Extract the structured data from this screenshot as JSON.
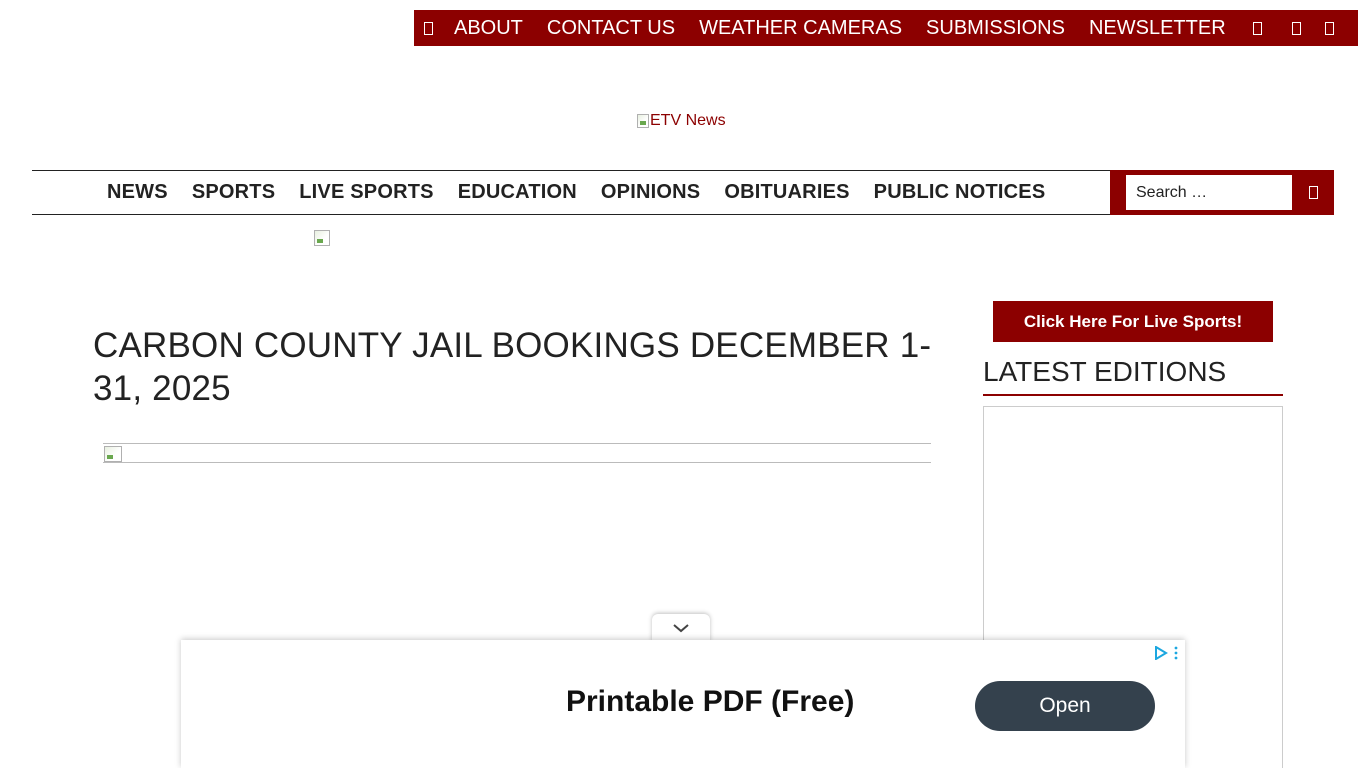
{
  "top_bar": {
    "links": [
      "ABOUT",
      "CONTACT US",
      "WEATHER CAMERAS",
      "SUBMISSIONS",
      "NEWSLETTER"
    ],
    "icons": [
      "home-icon",
      "facebook-icon",
      "twitter-icon",
      "instagram-icon"
    ]
  },
  "logo": {
    "alt_text": "ETV News"
  },
  "main_nav": {
    "items": [
      "NEWS",
      "SPORTS",
      "LIVE SPORTS",
      "EDUCATION",
      "OPINIONS",
      "OBITUARIES",
      "PUBLIC NOTICES"
    ],
    "search_placeholder": "Search …",
    "search_icon": "search-icon"
  },
  "article": {
    "title": "CARBON COUNTY JAIL BOOKINGS DECEMBER 1-31, 2025"
  },
  "sidebar": {
    "live_sports_label": "Click Here For Live Sports!",
    "editions_heading": "LATEST EDITIONS"
  },
  "ad": {
    "headline": "Printable PDF (Free)",
    "button_label": "Open"
  },
  "colors": {
    "brand": "#8c0000",
    "ad_button": "#34414d",
    "ad_choices": "#1ca7e0"
  }
}
